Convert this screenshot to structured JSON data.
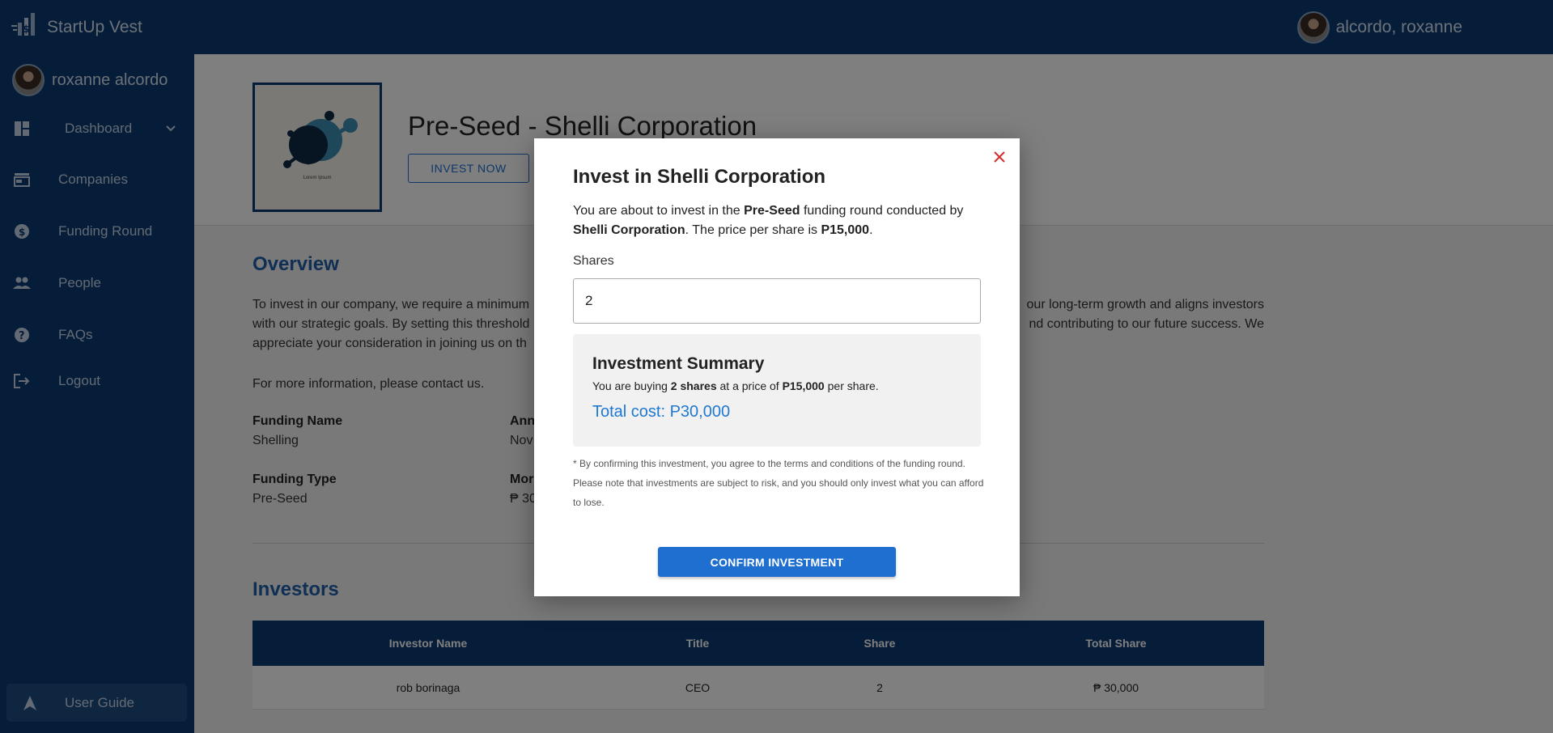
{
  "app": {
    "brand": "StartUp Vest"
  },
  "topbar": {
    "user_name": "alcordo, roxanne"
  },
  "sidebar": {
    "user_name": "roxanne alcordo",
    "items": [
      {
        "label": "Dashboard",
        "icon": "dashboard-icon"
      },
      {
        "label": "Companies",
        "icon": "store-icon"
      },
      {
        "label": "Funding Round",
        "icon": "dollar-circle-icon"
      },
      {
        "label": "People",
        "icon": "people-icon"
      },
      {
        "label": "FAQs",
        "icon": "help-icon"
      },
      {
        "label": "Logout",
        "icon": "logout-icon"
      }
    ],
    "guide_label": "User Guide"
  },
  "page": {
    "title": "Pre-Seed - Shelli Corporation",
    "invest_now": "INVEST NOW",
    "logo_caption": "Lorem Ipsum",
    "overview_heading": "Overview",
    "overview_line1_left": "To invest in our company, we require a minimum",
    "overview_line1_right": "our long-term growth and aligns investors",
    "overview_line2_left": "with our strategic goals. By setting this threshold",
    "overview_line2_right": "nd contributing to our future success. We",
    "overview_line3_left": "appreciate your consideration in joining us on th",
    "contact_text": "For more information, please contact us.",
    "fields": {
      "funding_name_label": "Funding Name",
      "funding_name_value": "Shelling",
      "announced_label": "Ann",
      "announced_value": "Nov",
      "funding_type_label": "Funding Type",
      "funding_type_value": "Pre-Seed",
      "money_label": "Mor",
      "money_value": "₱ 30"
    },
    "investors_heading": "Investors",
    "table": {
      "headers": [
        "Investor Name",
        "Title",
        "Share",
        "Total Share"
      ],
      "rows": [
        [
          "rob borinaga",
          "CEO",
          "2",
          "₱ 30,000"
        ]
      ]
    }
  },
  "modal": {
    "title": "Invest in Shelli Corporation",
    "desc_1": "You are about to invest in the ",
    "round": "Pre-Seed",
    "desc_2": " funding round conducted by ",
    "company": "Shelli Corporation",
    "desc_3": ". The price per share is ",
    "price": "P15,000",
    "desc_4": ".",
    "shares_label": "Shares",
    "shares_value": "2",
    "summary": {
      "title": "Investment Summary",
      "text_1": "You are buying ",
      "shares_bold": "2 shares",
      "text_2": " at a price of ",
      "price_bold": "P15,000",
      "text_3": " per share.",
      "total": "Total cost: P30,000"
    },
    "disclaimer": "* By confirming this investment, you agree to the terms and conditions of the funding round. Please note that investments are subject to risk, and you should only invest what you can afford to lose.",
    "confirm_label": "CONFIRM INVESTMENT"
  },
  "colors": {
    "navy": "#0b3a72",
    "accent_blue": "#1f6fd0",
    "total_blue": "#1f78d1",
    "close_red": "#d32f2f"
  }
}
